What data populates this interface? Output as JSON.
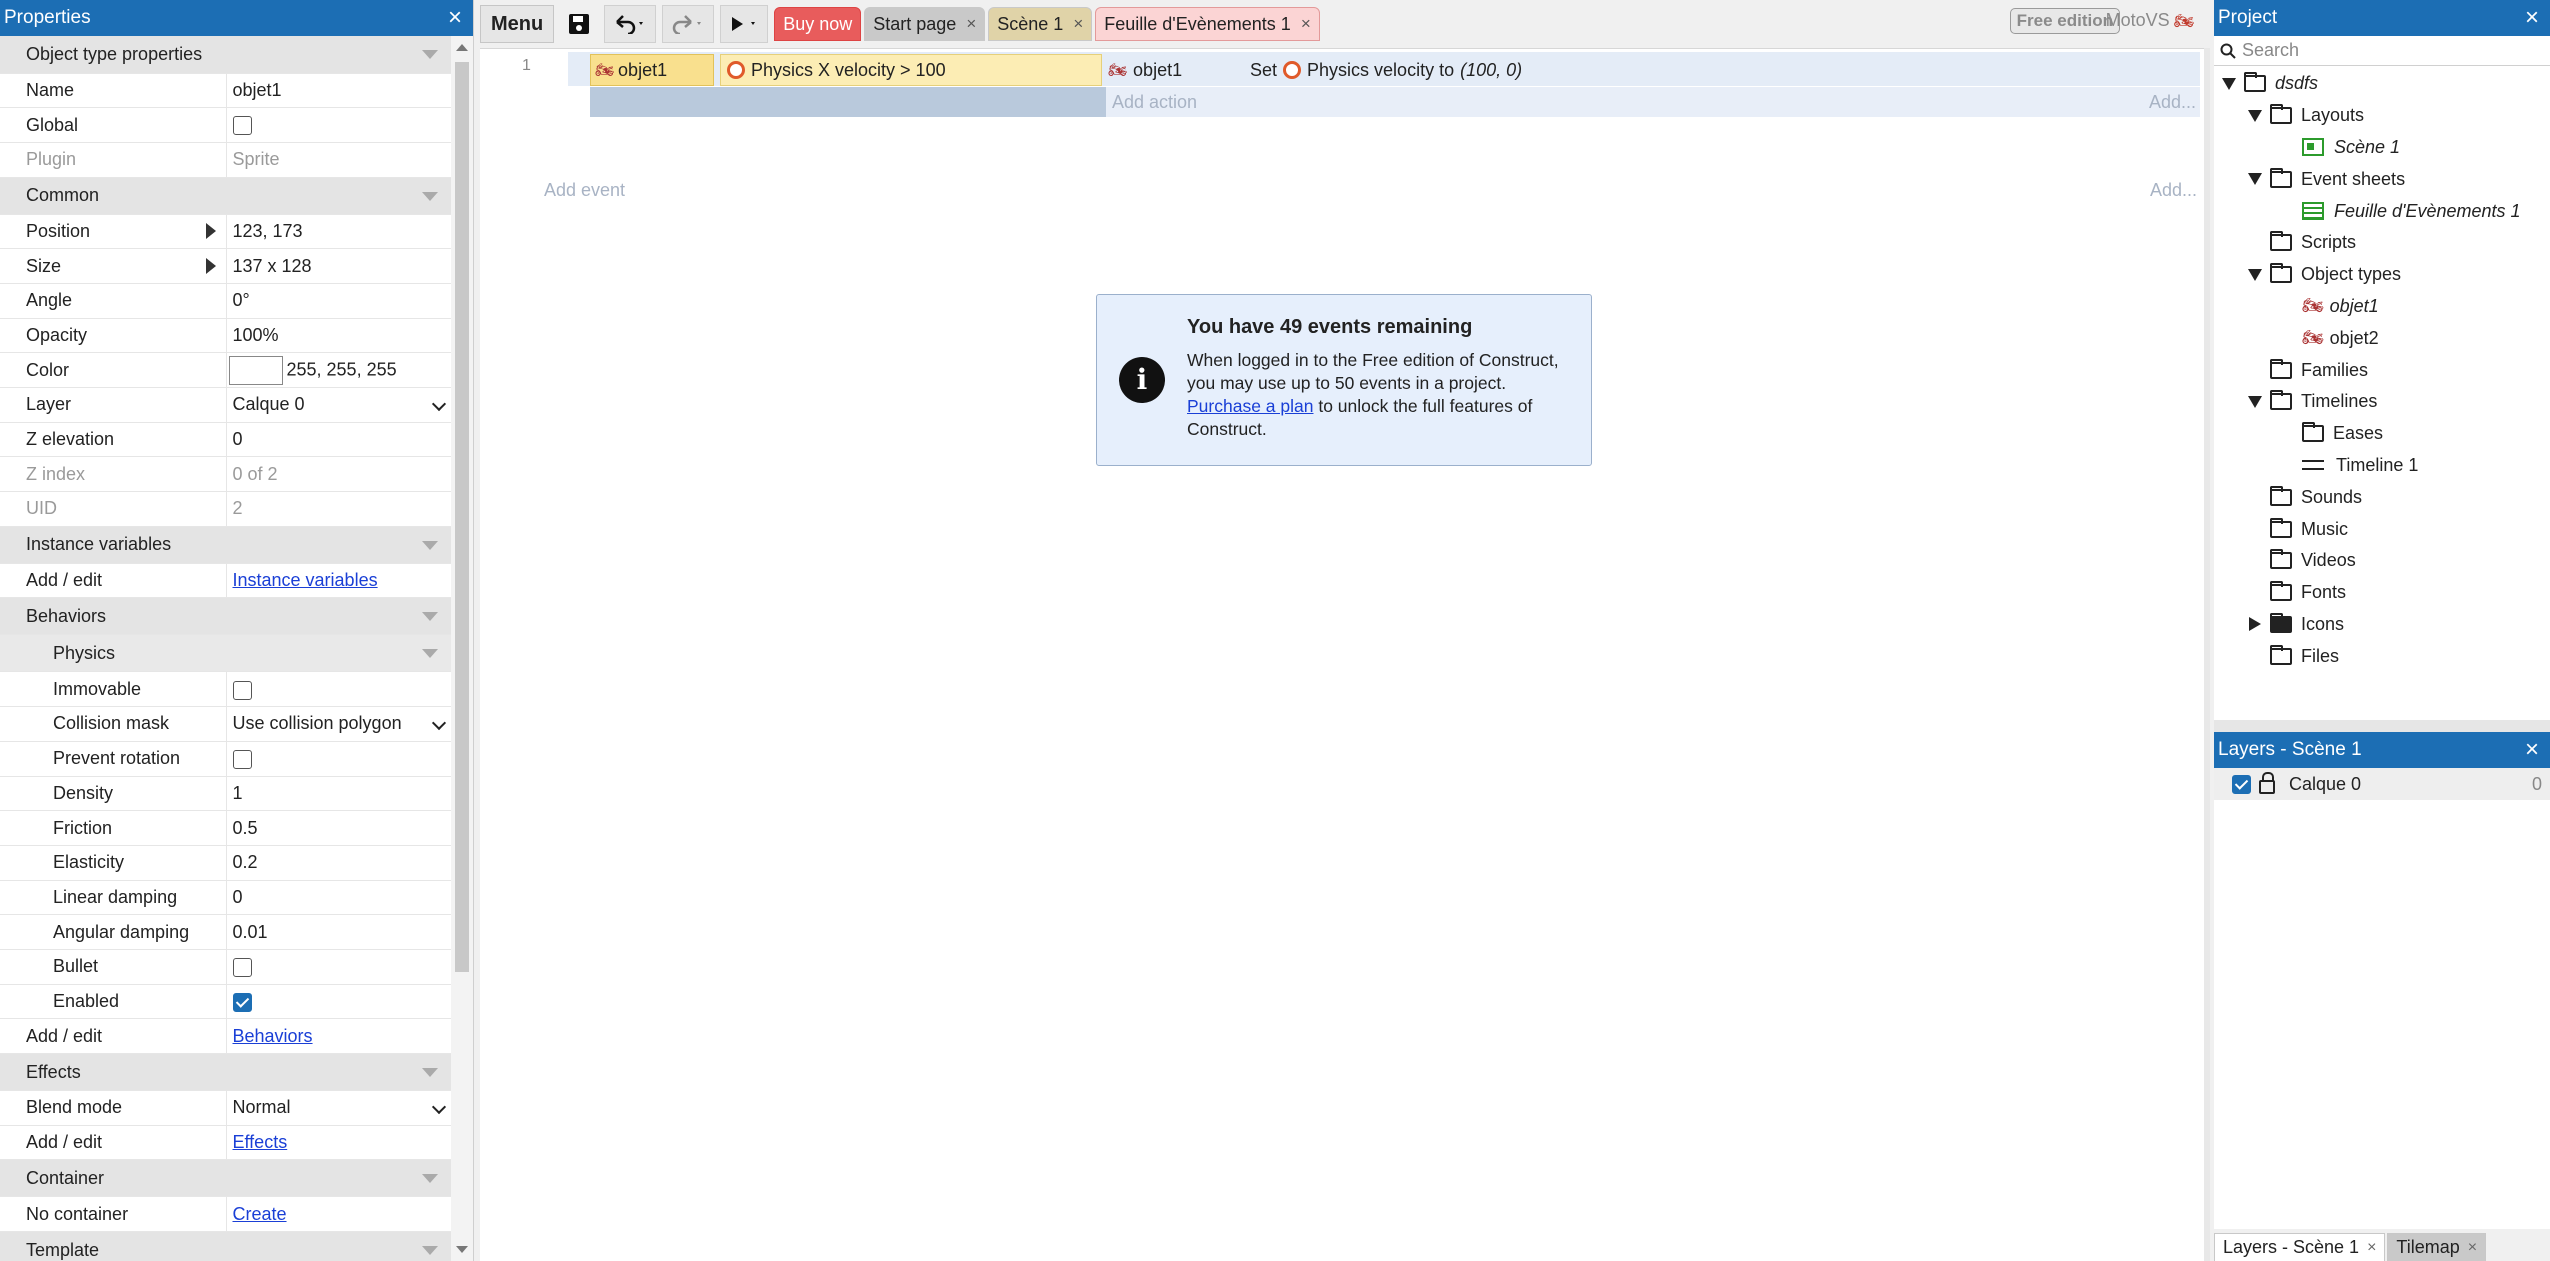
{
  "properties": {
    "title": "Properties",
    "sections": {
      "object_type": "Object type properties",
      "common": "Common",
      "instance_vars": "Instance variables",
      "behaviors": "Behaviors",
      "physics": "Physics",
      "effects": "Effects",
      "container": "Container",
      "template": "Template"
    },
    "rows": {
      "name": {
        "k": "Name",
        "v": "objet1"
      },
      "global": {
        "k": "Global",
        "checked": false
      },
      "plugin": {
        "k": "Plugin",
        "v": "Sprite"
      },
      "position": {
        "k": "Position",
        "v": "123, 173"
      },
      "size": {
        "k": "Size",
        "v": "137 x 128"
      },
      "angle": {
        "k": "Angle",
        "v": "0°"
      },
      "opacity": {
        "k": "Opacity",
        "v": "100%"
      },
      "color": {
        "k": "Color",
        "v": "255, 255, 255"
      },
      "layer": {
        "k": "Layer",
        "v": "Calque 0"
      },
      "z_elevation": {
        "k": "Z elevation",
        "v": "0"
      },
      "z_index": {
        "k": "Z index",
        "v": "0 of 2"
      },
      "uid": {
        "k": "UID",
        "v": "2"
      },
      "iv_add": {
        "k": "Add / edit",
        "v": "Instance variables"
      },
      "immovable": {
        "k": "Immovable",
        "checked": false
      },
      "collision_mask": {
        "k": "Collision mask",
        "v": "Use collision polygon"
      },
      "prevent_rotation": {
        "k": "Prevent rotation",
        "checked": false
      },
      "density": {
        "k": "Density",
        "v": "1"
      },
      "friction": {
        "k": "Friction",
        "v": "0.5"
      },
      "elasticity": {
        "k": "Elasticity",
        "v": "0.2"
      },
      "linear_damping": {
        "k": "Linear damping",
        "v": "0"
      },
      "angular_damping": {
        "k": "Angular damping",
        "v": "0.01"
      },
      "bullet": {
        "k": "Bullet",
        "checked": false
      },
      "enabled": {
        "k": "Enabled",
        "checked": true
      },
      "beh_add": {
        "k": "Add / edit",
        "v": "Behaviors"
      },
      "blend_mode": {
        "k": "Blend mode",
        "v": "Normal"
      },
      "fx_add": {
        "k": "Add / edit",
        "v": "Effects"
      },
      "container": {
        "k": "No container",
        "v": "Create"
      }
    }
  },
  "toolbar": {
    "menu_label": "Menu",
    "tabs": {
      "buy": "Buy now",
      "start": "Start page",
      "scene": "Scène 1",
      "sheet": "Feuille d'Evènements 1"
    },
    "close_glyph": "×",
    "edition": "Free edition",
    "app_name": "MotoVS"
  },
  "event_sheet": {
    "event_number": "1",
    "condition_object": "objet1",
    "condition_text": "Physics X velocity > 100",
    "action_object": "objet1",
    "action_set": "Set",
    "action_text": "Physics velocity to",
    "action_value": "(100, 0)",
    "add_action": "Add action",
    "add_right": "Add...",
    "add_event": "Add event",
    "add_event_right": "Add...",
    "notice": {
      "title": "You have 49 events remaining",
      "text1": "When logged in to the Free edition of Construct, you may use up to 50 events in a project.",
      "link": "Purchase a plan",
      "text2": " to unlock the full features of Construct."
    }
  },
  "project": {
    "title": "Project",
    "search_placeholder": "Search",
    "root": "dsdfs",
    "nodes": {
      "layouts": "Layouts",
      "scene": "Scène 1",
      "event_sheets": "Event sheets",
      "sheet": "Feuille d'Evènements 1",
      "scripts": "Scripts",
      "object_types": "Object types",
      "objet1": "objet1",
      "objet2": "objet2",
      "families": "Families",
      "timelines": "Timelines",
      "eases": "Eases",
      "timeline1": "Timeline 1",
      "sounds": "Sounds",
      "music": "Music",
      "videos": "Videos",
      "fonts": "Fonts",
      "icons": "Icons",
      "files": "Files"
    }
  },
  "layers": {
    "title": "Layers - Scène 1",
    "layer_name": "Calque 0",
    "layer_count": "0",
    "visible": true,
    "bottom_tabs": {
      "layers": "Layers - Scène 1",
      "tilemap": "Tilemap"
    }
  },
  "colors": {
    "accent": "#1c6eb4",
    "buy_now": "#e85c5c",
    "condition_bg": "#fcedb4",
    "notice_bg": "#e6effc"
  },
  "icons": [
    "close-icon",
    "save-icon",
    "undo-icon",
    "redo-icon",
    "play-icon",
    "info-icon",
    "search-icon",
    "folder-icon",
    "lock-icon",
    "motorbike-icon",
    "physics-icon"
  ]
}
